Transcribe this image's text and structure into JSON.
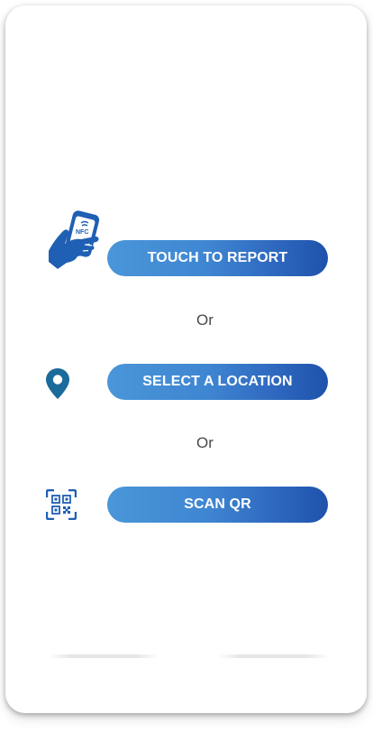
{
  "actions": {
    "nfc": {
      "label": "TOUCH TO REPORT",
      "icon": "nfc-phone-hand-icon",
      "icon_text": "NFC"
    },
    "location": {
      "label": "SELECT A LOCATION",
      "icon": "location-pin-icon"
    },
    "qr": {
      "label": "SCAN QR",
      "icon": "qr-scan-icon"
    }
  },
  "separators": {
    "first": "Or",
    "second": "Or"
  },
  "colors": {
    "button_gradient_start": "#4a96d9",
    "button_gradient_end": "#1f52ab",
    "icon_blue": "#1f5fb4",
    "pin_blue": "#1b6a9c"
  }
}
